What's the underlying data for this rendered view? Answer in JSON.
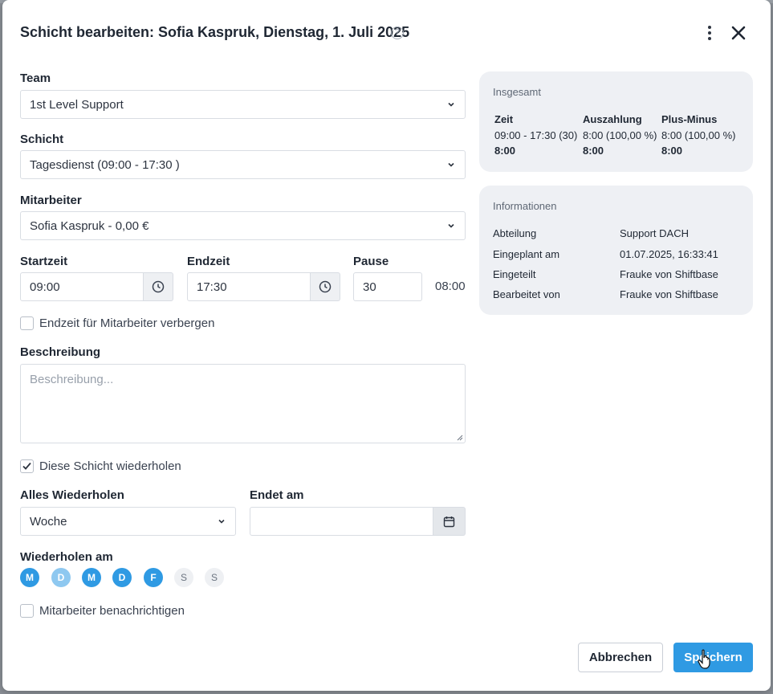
{
  "dialog": {
    "title": "Schicht bearbeiten: Sofia Kaspruk, Dienstag, 1. Juli 2025",
    "help_icon": "?",
    "menu_icon": "kebab-vertical-icon",
    "close_icon": "close-icon"
  },
  "form": {
    "team_label": "Team",
    "team_value": "1st Level Support",
    "shift_label": "Schicht",
    "shift_value": "Tagesdienst (09:00 - 17:30 )",
    "employee_label": "Mitarbeiter",
    "employee_value": "Sofia Kaspruk - 0,00 €",
    "start_label": "Startzeit",
    "start_value": "09:00",
    "end_label": "Endzeit",
    "end_value": "17:30",
    "break_label": "Pause",
    "break_value": "30",
    "duration": "08:00",
    "hide_end_label": "Endzeit für Mitarbeiter verbergen",
    "hide_end_checked": false,
    "description_label": "Beschreibung",
    "description_placeholder": "Beschreibung...",
    "repeat_label": "Diese Schicht wiederholen",
    "repeat_checked": true,
    "repeat_every_label": "Alles Wiederholen",
    "repeat_every_value": "Woche",
    "ends_on_label": "Endet am",
    "ends_on_value": "",
    "repeat_on_label": "Wiederholen am",
    "days": [
      {
        "letter": "M",
        "state": "on"
      },
      {
        "letter": "D",
        "state": "half"
      },
      {
        "letter": "M",
        "state": "on"
      },
      {
        "letter": "D",
        "state": "on"
      },
      {
        "letter": "F",
        "state": "on"
      },
      {
        "letter": "S",
        "state": "off"
      },
      {
        "letter": "S",
        "state": "off"
      }
    ],
    "notify_label": "Mitarbeiter benachrichtigen",
    "notify_checked": false
  },
  "summary": {
    "title": "Insgesamt",
    "columns": [
      {
        "header": "Zeit",
        "line1": "09:00 - 17:30 (30)",
        "line2": "8:00"
      },
      {
        "header": "Auszahlung",
        "line1": "8:00 (100,00 %)",
        "line2": "8:00"
      },
      {
        "header": "Plus-Minus",
        "line1": "8:00 (100,00 %)",
        "line2": "8:00"
      }
    ]
  },
  "info": {
    "title": "Informationen",
    "rows": [
      {
        "key": "Abteilung",
        "value": "Support DACH"
      },
      {
        "key": "Eingeplant am",
        "value": "01.07.2025, 16:33:41"
      },
      {
        "key": "Eingeteilt",
        "value": "Frauke von Shiftbase"
      },
      {
        "key": "Bearbeitet von",
        "value": "Frauke von Shiftbase"
      }
    ]
  },
  "buttons": {
    "cancel": "Abbrechen",
    "save": "Speichern"
  },
  "colors": {
    "accent": "#2f9ae3",
    "accent_light": "#8ec8f0",
    "panel_bg": "#eef0f4"
  }
}
